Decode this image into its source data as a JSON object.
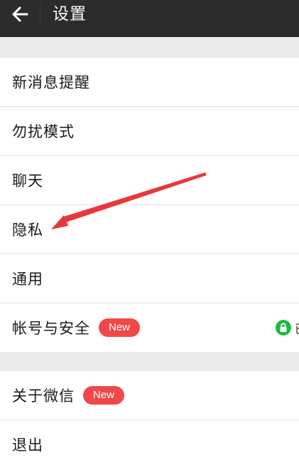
{
  "header": {
    "title": "设置",
    "back_icon": "arrow-left-icon",
    "background": "#2c2c2c"
  },
  "groups": [
    {
      "items": [
        {
          "label": "新消息提醒"
        },
        {
          "label": "勿扰模式"
        },
        {
          "label": "聊天"
        },
        {
          "label": "隐私"
        },
        {
          "label": "通用"
        },
        {
          "label": "帐号与安全",
          "badge": "New",
          "right_icon": "lock-icon",
          "right_text": "已"
        }
      ]
    },
    {
      "items": [
        {
          "label": "关于微信",
          "badge": "New"
        },
        {
          "label": "退出"
        }
      ]
    }
  ],
  "colors": {
    "badge": "#f04848",
    "lock": "#20b845",
    "annotation_arrow": "#e8383a",
    "background": "#ebebeb"
  }
}
